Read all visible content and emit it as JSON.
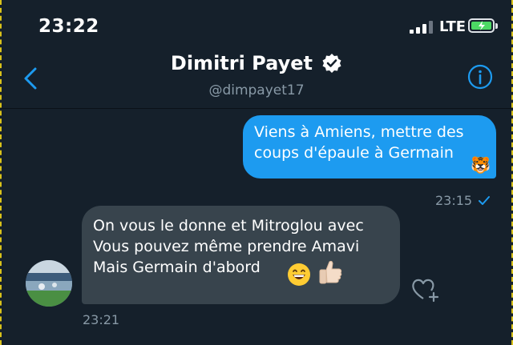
{
  "status_bar": {
    "time": "23:22",
    "network": "LTE"
  },
  "header": {
    "name": "Dimitri Payet",
    "handle": "@dimpayet17"
  },
  "messages": {
    "outgoing": {
      "lines": [
        "Viens à Amiens, mettre des",
        "coups d'épaule à Germain"
      ],
      "emoji": "🐯",
      "time": "23:15"
    },
    "incoming": {
      "lines": [
        "On vous le donne et Mitroglou avec",
        "Vous pouvez même prendre Amavi",
        "Mais Germain d'abord"
      ],
      "time": "23:21"
    }
  },
  "colors": {
    "background": "#15202b",
    "outgoing_bubble": "#1d9bf0",
    "incoming_bubble": "#38444d",
    "accent": "#1d9bf0",
    "muted_text": "#8899a6"
  },
  "icons": [
    "back-chevron-icon",
    "verified-badge-icon",
    "info-icon",
    "delivered-check-icon",
    "like-add-icon",
    "signal-icon",
    "battery-charging-icon"
  ]
}
